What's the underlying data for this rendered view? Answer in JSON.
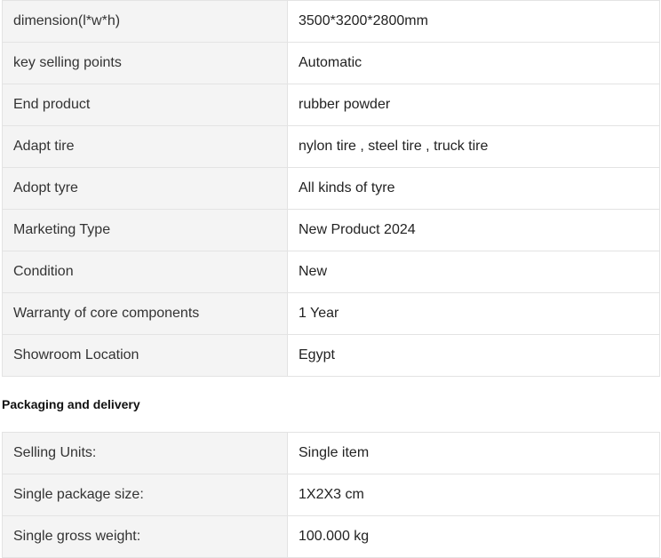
{
  "specs": [
    {
      "key": "dimension(l*w*h)",
      "value": "3500*3200*2800mm"
    },
    {
      "key": "key selling points",
      "value": "Automatic"
    },
    {
      "key": "End product",
      "value": "rubber powder"
    },
    {
      "key": "Adapt tire",
      "value": "nylon tire , steel tire , truck tire"
    },
    {
      "key": "Adopt tyre",
      "value": "All kinds of tyre"
    },
    {
      "key": "Marketing Type",
      "value": "New Product 2024"
    },
    {
      "key": "Condition",
      "value": "New"
    },
    {
      "key": "Warranty of core components",
      "value": "1 Year"
    },
    {
      "key": "Showroom Location",
      "value": "Egypt"
    }
  ],
  "packaging": {
    "title": "Packaging and delivery",
    "rows": [
      {
        "key": "Selling Units:",
        "value": "Single item"
      },
      {
        "key": "Single package size:",
        "value": "1X2X3 cm"
      },
      {
        "key": "Single gross weight:",
        "value": "100.000 kg"
      }
    ]
  }
}
